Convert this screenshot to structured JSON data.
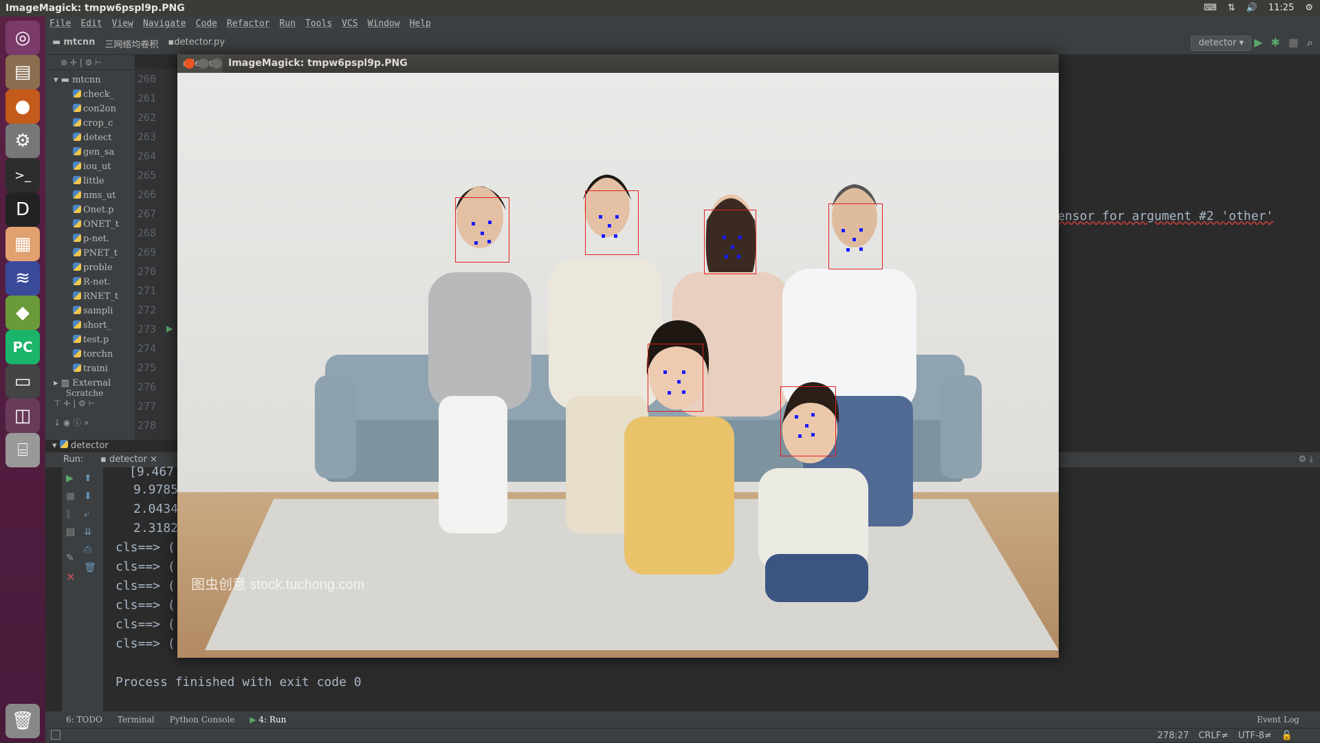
{
  "top_panel": {
    "title": "ImageMagick: tmpw6pspl9p.PNG",
    "time": "11:25"
  },
  "menu": [
    "File",
    "Edit",
    "View",
    "Navigate",
    "Code",
    "Refactor",
    "Run",
    "Tools",
    "VCS",
    "Window",
    "Help"
  ],
  "nav": {
    "project": "mtcnn",
    "folder": "三网络均卷积",
    "file": "detector.py",
    "run_config": "detector"
  },
  "project_tree": {
    "root": "mtcnn",
    "items": [
      "check_",
      "con2on",
      "crop_c",
      "detect",
      "gen_sa",
      "iou_ut",
      "little",
      "nms_ut",
      "Onet.p",
      "ONET_t",
      "p-net.",
      "PNET_t",
      "proble",
      "R-net.",
      "RNET_t",
      "sampli",
      "short_",
      "test.p",
      "torchn",
      "traini"
    ],
    "external": "External",
    "scratches": "Scratche"
  },
  "gutter_lines": [
    "260",
    "261",
    "262",
    "263",
    "264",
    "265",
    "266",
    "267",
    "268",
    "269",
    "270",
    "271",
    "272",
    "273",
    "274",
    "275",
    "276",
    "277",
    "278"
  ],
  "editor_text": "ensor for argument #2 'other'",
  "run": {
    "label": "Run:",
    "tab": "detector",
    "tree_root": "detector"
  },
  "console_lines": [
    "[9.467",
    "9.9785",
    "2.0434",
    "2.3182",
    "cls==> (",
    "cls==> (",
    "cls==> (",
    "cls==> (",
    "cls==> (",
    "cls==> ("
  ],
  "console_final": "Process finished with exit code 0",
  "bottom_tabs": [
    "6: TODO",
    "Terminal",
    "Python Console",
    "4: Run"
  ],
  "event_log": "Event Log",
  "status": {
    "position": "278:27",
    "line_ending": "CRLF≠",
    "encoding": "UTF-8≠"
  },
  "image_window": {
    "title": "ImageMagick: tmpw6pspl9p.PNG",
    "tab": "detec",
    "watermark": "图虫创意 stock.tuchong.com"
  },
  "colors": {
    "launcher": "#5a2145",
    "face_box": "#e02020",
    "landmark": "#1a1aff"
  }
}
